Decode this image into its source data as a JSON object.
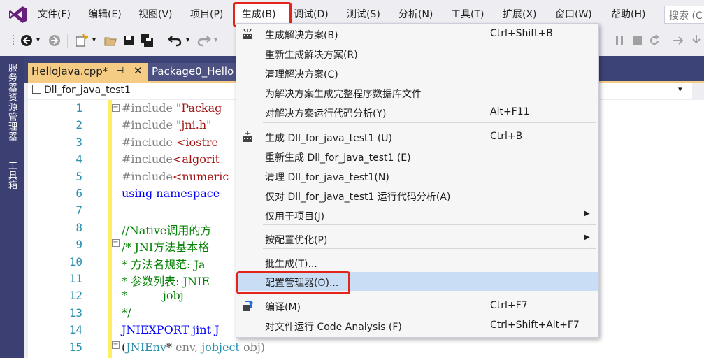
{
  "menubar": {
    "items": [
      "文件(F)",
      "编辑(E)",
      "视图(V)",
      "项目(P)",
      "生成(B)",
      "调试(D)",
      "测试(S)",
      "分析(N)",
      "工具(T)",
      "扩展(X)",
      "窗口(W)",
      "帮助(H)"
    ],
    "search_placeholder": "搜索 (C"
  },
  "side_strip": {
    "server_explorer": "服务器资源管理器",
    "toolbox": "工具箱"
  },
  "tabs": {
    "active": {
      "label": "HelloJava.cpp*",
      "pin": "⊣",
      "close": "✕"
    },
    "inactive": {
      "label": "Package0_Hello"
    }
  },
  "navbar": {
    "project": "Dll_for_java_test1",
    "dropdown": "▾"
  },
  "editor": {
    "line_numbers": [
      "1",
      "2",
      "3",
      "4",
      "5",
      "6",
      "7",
      "8",
      "9",
      "10",
      "11",
      "12",
      "13",
      "14",
      "15"
    ],
    "lines": [
      [
        {
          "c": "pp",
          "t": "#include "
        },
        {
          "c": "str",
          "t": "\"Packag"
        }
      ],
      [
        {
          "c": "pp",
          "t": "#include "
        },
        {
          "c": "str",
          "t": "\"jni.h\""
        }
      ],
      [
        {
          "c": "pp",
          "t": "#include "
        },
        {
          "c": "str",
          "t": "<iostre"
        }
      ],
      [
        {
          "c": "pp",
          "t": "#include"
        },
        {
          "c": "str",
          "t": "<algorit"
        }
      ],
      [
        {
          "c": "pp",
          "t": "#include"
        },
        {
          "c": "str",
          "t": "<numeric"
        }
      ],
      [
        {
          "c": "kw",
          "t": "using namespace"
        }
      ],
      [
        {
          "c": "",
          "t": ""
        }
      ],
      [
        {
          "c": "cm",
          "t": "//Native调用的方"
        }
      ],
      [
        {
          "c": "cm",
          "t": "/* JNI方法基本格"
        }
      ],
      [
        {
          "c": "cm",
          "t": "* 方法名规范: Ja"
        }
      ],
      [
        {
          "c": "cm",
          "t": "* 参数列表: JNIE"
        }
      ],
      [
        {
          "c": "cm",
          "t": "*          jobj"
        }
      ],
      [
        {
          "c": "cm",
          "t": "*/"
        }
      ],
      [
        {
          "c": "kw",
          "t": "JNIEXPORT jint J"
        }
      ],
      [
        {
          "c": "",
          "t": "("
        },
        {
          "c": "ty",
          "t": "JNIEnv"
        },
        {
          "c": "",
          "t": "* "
        },
        {
          "c": "pp",
          "t": "env, "
        },
        {
          "c": "ty",
          "t": "jobject "
        },
        {
          "c": "pp",
          "t": "obj)"
        }
      ]
    ]
  },
  "build_menu": {
    "items": [
      {
        "label": "生成解决方案(B)",
        "shortcut": "Ctrl+Shift+B",
        "icon": "build-solution-icon"
      },
      {
        "label": "重新生成解决方案(R)",
        "shortcut": ""
      },
      {
        "label": "清理解决方案(C)",
        "shortcut": ""
      },
      {
        "label": "为解决方案生成完整程序数据库文件",
        "shortcut": ""
      },
      {
        "label": "对解决方案运行代码分析(Y)",
        "shortcut": "Alt+F11"
      },
      {
        "label": "生成 Dll_for_java_test1 (U)",
        "shortcut": "Ctrl+B",
        "icon": "build-project-icon"
      },
      {
        "label": "重新生成 Dll_for_java_test1 (E)",
        "shortcut": ""
      },
      {
        "label": "清理 Dll_for_java_test1(N)",
        "shortcut": ""
      },
      {
        "label": "仅对 Dll_for_java_test1 运行代码分析(A)",
        "shortcut": ""
      },
      {
        "label": "仅用于项目(J)",
        "shortcut": "",
        "submenu": true
      },
      {
        "label": "按配置优化(P)",
        "shortcut": "",
        "submenu": true
      },
      {
        "label": "批生成(T)...",
        "shortcut": ""
      },
      {
        "label": "配置管理器(O)...",
        "shortcut": "",
        "highlighted": true
      },
      {
        "label": "编译(M)",
        "shortcut": "Ctrl+F7",
        "icon": "compile-icon"
      },
      {
        "label": "对文件运行 Code Analysis (F)",
        "shortcut": "Ctrl+Shift+Alt+F7"
      }
    ]
  },
  "colors": {
    "accent_red": "#E3241B",
    "tab_active": "#F5CC84",
    "menu_highlight": "#C9DEF5",
    "side_strip": "#3C3F72"
  }
}
